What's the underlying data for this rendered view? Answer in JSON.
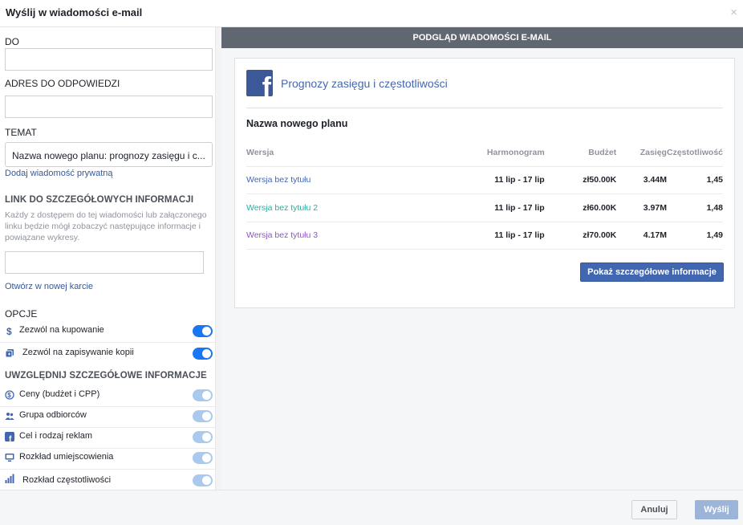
{
  "window": {
    "title": "Wyślij w wiadomości e-mail",
    "close_glyph": "×"
  },
  "form": {
    "to_label": "DO",
    "to_value": "",
    "reply_label": "ADRES DO ODPOWIEDZI",
    "reply_value": "",
    "subject_label": "TEMAT",
    "subject_value": "Nazwa nowego planu: prognozy zasięgu i c...",
    "private_message_link": "Dodaj wiadomość prywatną",
    "details_link_heading": "LINK DO SZCZEGÓŁOWYCH INFORMACJI",
    "details_link_desc": "Każdy z dostępem do tej wiadomości lub załączonego linku będzie mógł zobaczyć następujące informacje i powiązane wykresy.",
    "details_link_value": "",
    "open_new_tab": "Otwórz w nowej karcie",
    "options_heading": "OPCJE",
    "options": [
      {
        "label": "Zezwól na kupowanie",
        "icon": "dollar-icon",
        "on": true
      },
      {
        "label": "Zezwól na zapisywanie kopii",
        "icon": "copy-icon",
        "on": true
      }
    ],
    "include_heading": "UWZGLĘDNIJ SZCZEGÓŁOWE INFORMACJE",
    "include": [
      {
        "label": "Ceny (budżet i CPP)",
        "icon": "price-icon",
        "on": true
      },
      {
        "label": "Grupa odbiorców",
        "icon": "people-icon",
        "on": true
      },
      {
        "label": "Cel i rodzaj reklam",
        "icon": "facebook-icon",
        "on": true
      },
      {
        "label": "Rozkład umiejscowienia",
        "icon": "monitor-icon",
        "on": true
      },
      {
        "label": "Rozkład częstotliwości",
        "icon": "bar-chart-icon",
        "on": true
      }
    ]
  },
  "preview": {
    "header": "PODGLĄD WIADOMOŚCI E-MAIL",
    "logo_letter": "f",
    "app_title": "Prognozy zasięgu i częstotliwości",
    "plan_name": "Nazwa nowego planu",
    "columns": [
      "Wersja",
      "Harmonogram",
      "Budżet",
      "Zasięg",
      "Częstotliwość"
    ],
    "rows": [
      {
        "name": "Wersja bez tytułu",
        "schedule": "11 lip - 17 lip",
        "budget": "zł50.00K",
        "reach": "3.44M",
        "freq": "1,45",
        "color": "#4267b2"
      },
      {
        "name": "Wersja bez tytułu 2",
        "schedule": "11 lip - 17 lip",
        "budget": "zł60.00K",
        "reach": "3.97M",
        "freq": "1,48",
        "color": "#20b2a0"
      },
      {
        "name": "Wersja bez tytułu 3",
        "schedule": "11 lip - 17 lip",
        "budget": "zł70.00K",
        "reach": "4.17M",
        "freq": "1,49",
        "color": "#8c55c7"
      }
    ],
    "details_button": "Pokaż szczegółowe informacje"
  },
  "footer": {
    "cancel": "Anuluj",
    "send": "Wyślij"
  },
  "colors": {
    "accent": "#4267b2",
    "toggle_on": "#1877f2",
    "toggle_light": "#a9c9ef",
    "header": "#606770"
  }
}
